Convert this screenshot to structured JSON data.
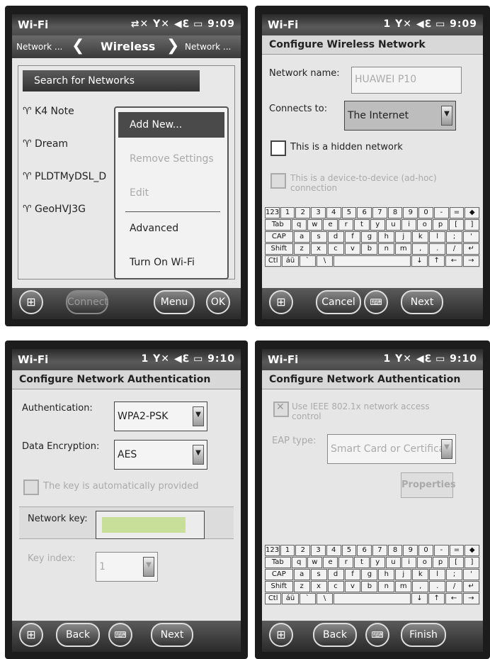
{
  "panel1": {
    "status": {
      "title": "Wi-Fi",
      "icons": "⇄✕ Y✕ ◀ℇ ▭",
      "time": "9:09"
    },
    "nav": {
      "left": "Network ...",
      "center": "Wireless",
      "right": "Network ..."
    },
    "search_button": "Search for Networks",
    "networks": [
      "K4 Note",
      "Dream",
      "PLDTMyDSL_D",
      "GeoHVJ3G"
    ],
    "menu": {
      "items": [
        {
          "label": "Add New...",
          "state": "highlighted"
        },
        {
          "label": "Remove Settings",
          "state": "disabled"
        },
        {
          "label": "Edit",
          "state": "disabled"
        },
        {
          "label": "Advanced",
          "state": "enabled"
        },
        {
          "label": "Turn On Wi-Fi",
          "state": "enabled"
        }
      ]
    },
    "softkeys": {
      "left": "Connect",
      "menu": "Menu",
      "ok": "OK"
    }
  },
  "panel2": {
    "status": {
      "title": "Wi-Fi",
      "icons": "1 Y✕ ◀ℇ ▭",
      "time": "9:09"
    },
    "heading": "Configure Wireless Network",
    "network_name_label": "Network name:",
    "network_name_value": "HUAWEI P10",
    "connects_to_label": "Connects to:",
    "connects_to_value": "The Internet",
    "hidden_checkbox": "This is a hidden network",
    "adhoc_checkbox": "This is a device-to-device (ad-hoc) connection",
    "softkeys": {
      "cancel": "Cancel",
      "next": "Next"
    }
  },
  "panel3": {
    "status": {
      "title": "Wi-Fi",
      "icons": "1 Y✕ ◀ℇ ▭",
      "time": "9:10"
    },
    "heading": "Configure Network Authentication",
    "auth_label": "Authentication:",
    "auth_value": "WPA2-PSK",
    "enc_label": "Data Encryption:",
    "enc_value": "AES",
    "auto_key_checkbox": "The key is automatically provided",
    "network_key_label": "Network key:",
    "key_index_label": "Key index:",
    "key_index_value": "1",
    "softkeys": {
      "back": "Back",
      "next": "Next"
    }
  },
  "panel4": {
    "status": {
      "title": "Wi-Fi",
      "icons": "1 Y✕ ◀ℇ ▭",
      "time": "9:10"
    },
    "heading": "Configure Network Authentication",
    "ieee_checkbox": "Use IEEE 802.1x network access control",
    "eap_label": "EAP type:",
    "eap_value": "Smart Card or Certificat",
    "properties_button": "Properties",
    "softkeys": {
      "back": "Back",
      "finish": "Finish"
    }
  },
  "keyboard": {
    "row1": [
      "123",
      "1",
      "2",
      "3",
      "4",
      "5",
      "6",
      "7",
      "8",
      "9",
      "0",
      "-",
      "=",
      "◆"
    ],
    "row2": [
      "Tab",
      "q",
      "w",
      "e",
      "r",
      "t",
      "y",
      "u",
      "i",
      "o",
      "p",
      "[",
      "]"
    ],
    "row3": [
      "CAP",
      "a",
      "s",
      "d",
      "f",
      "g",
      "h",
      "j",
      "k",
      "l",
      ";",
      "'"
    ],
    "row4": [
      "Shift",
      "z",
      "x",
      "c",
      "v",
      "b",
      "n",
      "m",
      ",",
      ".",
      "/",
      "↵"
    ],
    "row5": [
      "Ctl",
      "áü",
      "`",
      "\\",
      "",
      "",
      "",
      "",
      "",
      "↓",
      "↑",
      "←",
      "→"
    ]
  },
  "icons": [
    "windows-start-icon",
    "keyboard-icon",
    "wifi-signal-icon",
    "volume-icon",
    "battery-icon"
  ]
}
